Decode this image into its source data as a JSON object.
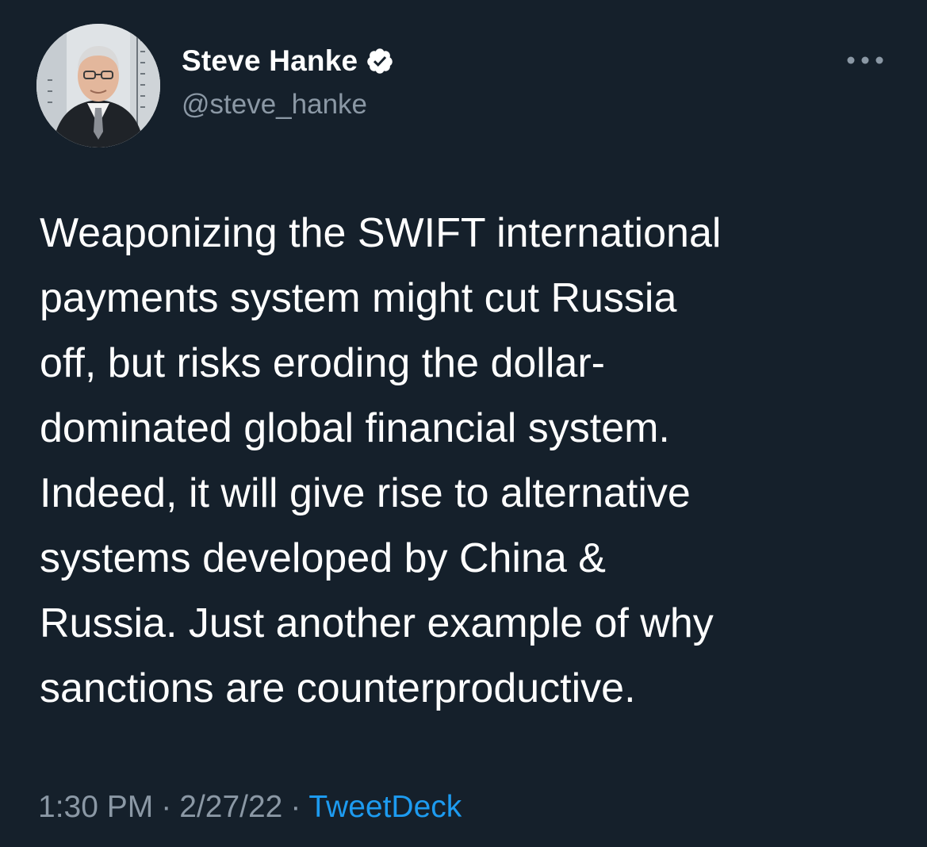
{
  "tweet": {
    "author": {
      "display_name": "Steve Hanke",
      "handle": "@steve_hanke",
      "verified_icon": "verified-badge-icon",
      "avatar_icon": "profile-photo"
    },
    "more_icon": "more-options-icon",
    "text_lines": [
      "Weaponizing the SWIFT international",
      "payments system might cut Russia",
      "off, but risks eroding the dollar-",
      "dominated global financial system.",
      "Indeed, it will give rise to alternative",
      "systems developed by China &",
      "Russia. Just another example of why",
      "sanctions are counterproductive."
    ],
    "time": "1:30 PM",
    "separator": "·",
    "date": "2/27/22",
    "source": "TweetDeck"
  },
  "colors": {
    "background": "#15202b",
    "text_primary": "#ffffff",
    "text_secondary": "#8b98a5",
    "link": "#1d9bf0"
  }
}
